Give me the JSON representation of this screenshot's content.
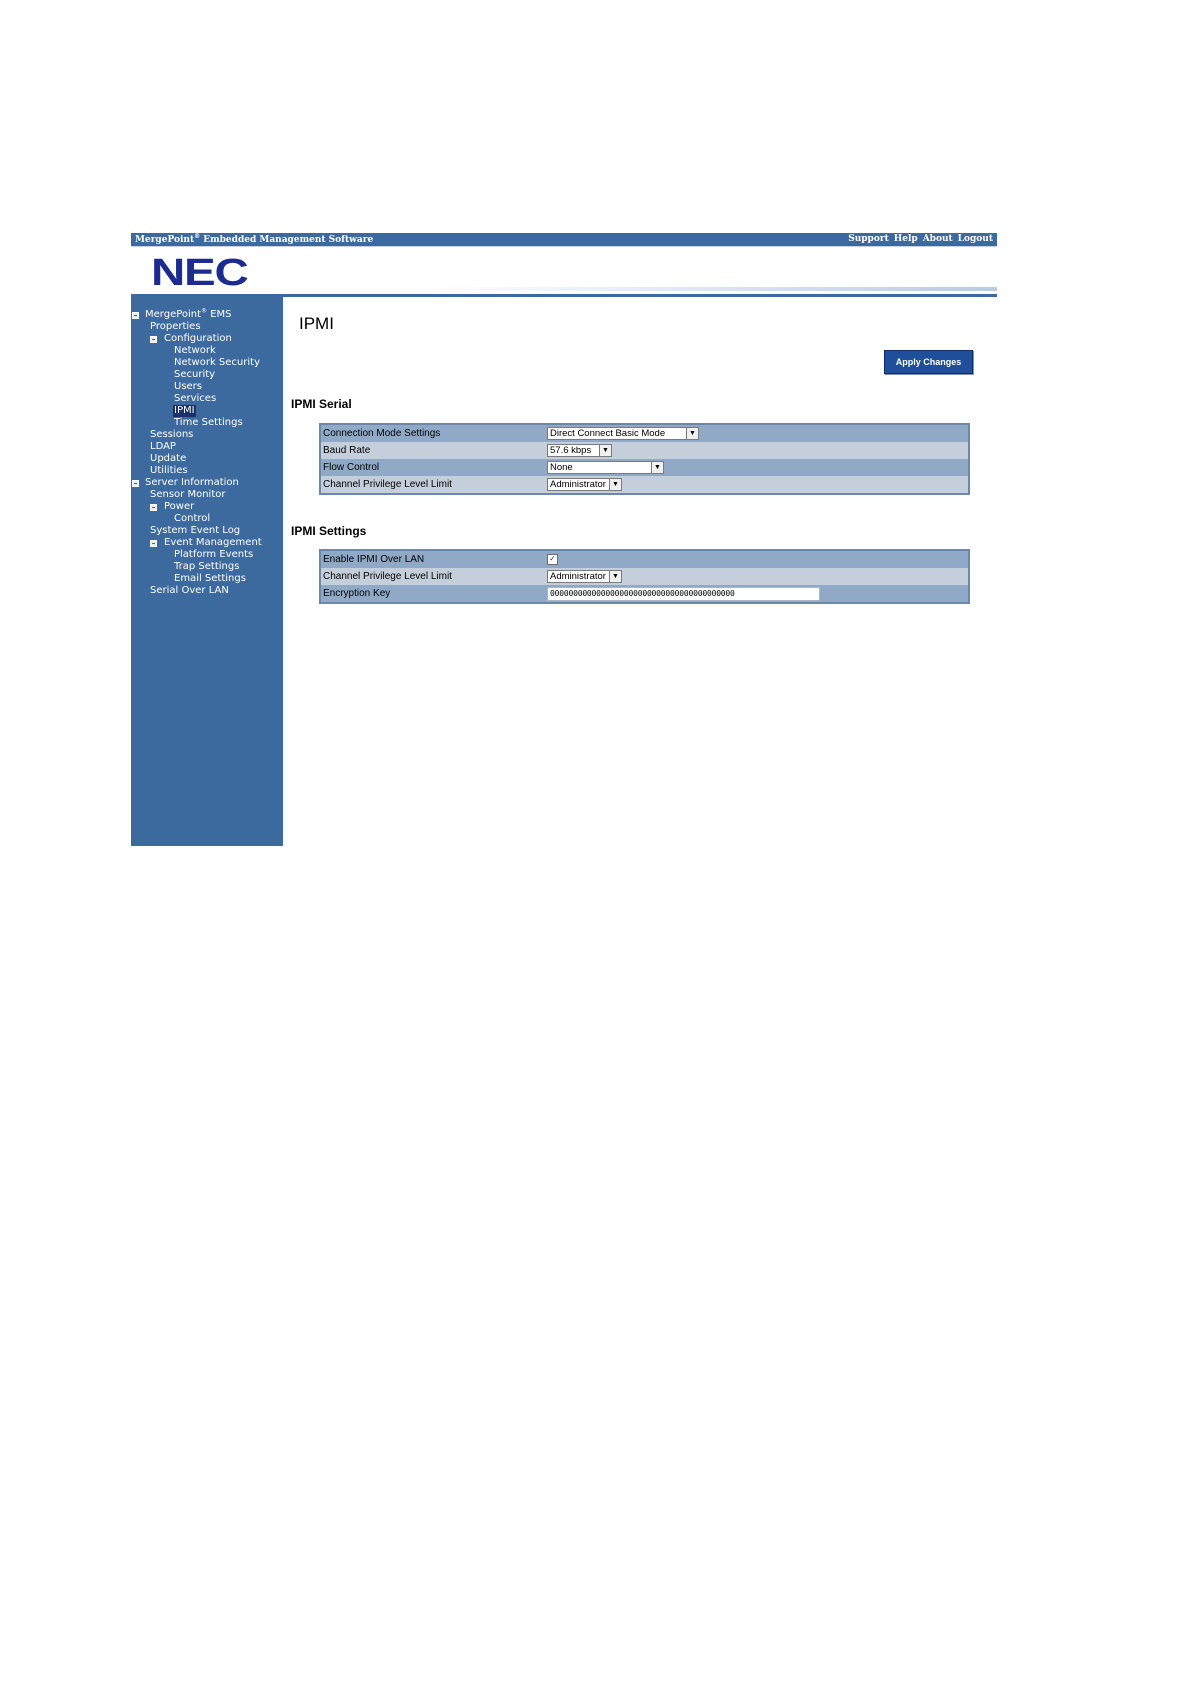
{
  "topbar": {
    "brand": "MergePoint",
    "brand_reg": "®",
    "brand_suffix": " Embedded Management Software",
    "links": [
      "Support",
      "Help",
      "About",
      "Logout"
    ]
  },
  "logo": {
    "text": "NEC"
  },
  "sidebar": {
    "root": {
      "label": "MergePoint",
      "reg": "®",
      "suffix": " EMS"
    },
    "properties": "Properties",
    "configuration": "Configuration",
    "config_items": [
      "Network",
      "Network Security",
      "Security",
      "Users",
      "Services",
      "IPMI",
      "Time Settings"
    ],
    "selected": "IPMI",
    "sessions": "Sessions",
    "ldap": "LDAP",
    "update": "Update",
    "utilities": "Utilities",
    "server_information": "Server Information",
    "sensor_monitor": "Sensor Monitor",
    "power": "Power",
    "control": "Control",
    "system_event_log": "System Event Log",
    "event_management": "Event Management",
    "event_items": [
      "Platform Events",
      "Trap Settings",
      "Email Settings"
    ],
    "serial_over_lan": "Serial Over LAN"
  },
  "main": {
    "title": "IPMI",
    "apply_label": "Apply Changes",
    "serial": {
      "title": "IPMI Serial",
      "rows": [
        {
          "label": "Connection Mode Settings",
          "value": "Direct Connect Basic Mode"
        },
        {
          "label": "Baud Rate",
          "value": "57.6 kbps"
        },
        {
          "label": "Flow Control",
          "value": "None"
        },
        {
          "label": "Channel Privilege Level Limit",
          "value": "Administrator"
        }
      ]
    },
    "settings": {
      "title": "IPMI Settings",
      "enable_label": "Enable IPMI Over LAN",
      "enable_checked": true,
      "privilege_label": "Channel Privilege Level Limit",
      "privilege_value": "Administrator",
      "key_label": "Encryption Key",
      "key_value": "0000000000000000000000000000000000000000"
    }
  },
  "colors": {
    "nav_blue": "#3d6a9e",
    "logo_blue": "#1d2b8f",
    "button_blue": "#1f4f9a",
    "selected_bg": "#1b2f6d"
  }
}
